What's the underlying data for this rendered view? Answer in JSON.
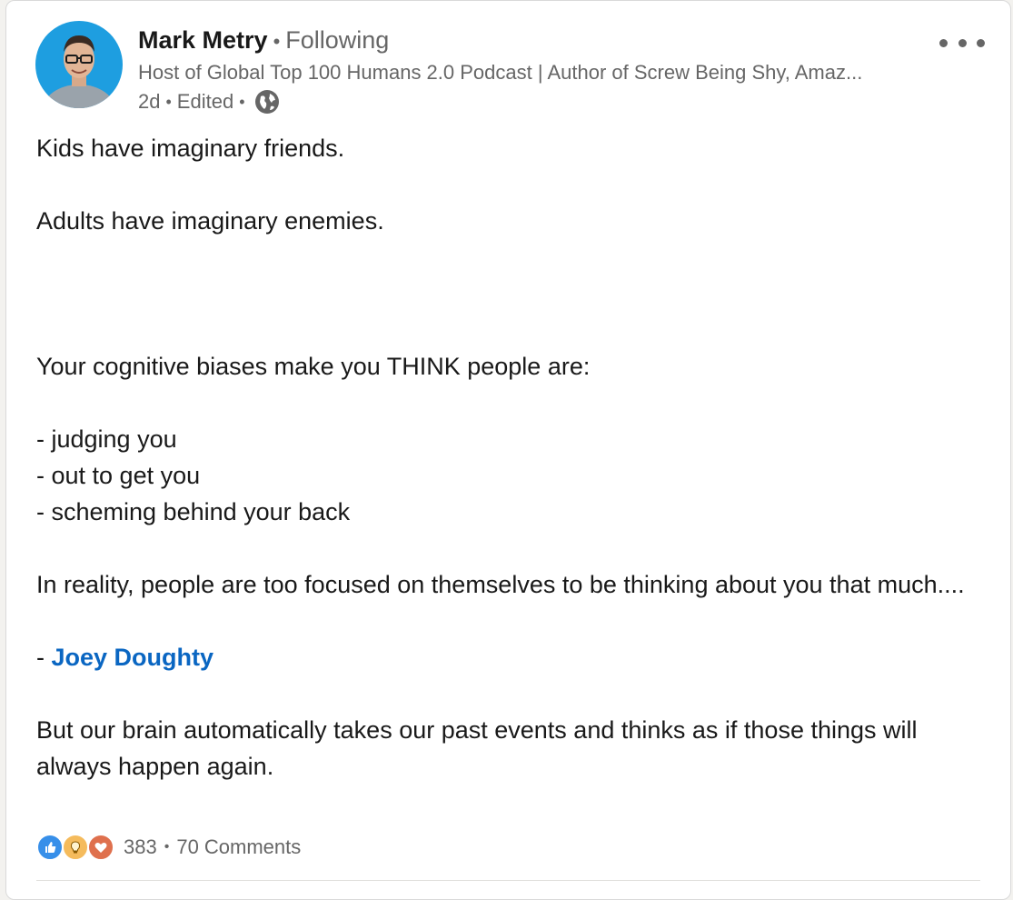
{
  "post": {
    "author": {
      "name": "Mark Metry",
      "follow_status": "Following",
      "headline": "Host of Global Top 100 Humans 2.0 Podcast | Author of Screw Being Shy, Amaz...",
      "time": "2d",
      "edited": "Edited"
    },
    "body": {
      "line1": "Kids have imaginary friends.",
      "line2": "Adults have imaginary enemies.",
      "line3": "Your cognitive biases make you THINK people are:",
      "bullet1": "- judging you",
      "bullet2": "- out to get you",
      "bullet3": "- scheming behind your back",
      "line4": "In reality, people are too focused on themselves to be thinking about you that much....",
      "quote_prefix": "- ",
      "mention": "Joey Doughty",
      "line5": "But our brain automatically takes our past events and thinks as if those things will always happen again."
    },
    "social": {
      "reaction_count": "383",
      "comments": "70 Comments",
      "reaction_icons": [
        "like-icon",
        "insightful-icon",
        "love-icon"
      ]
    }
  },
  "colors": {
    "link": "#0a66c2",
    "secondary_text": "#666666",
    "like": "#378fe9",
    "insightful": "#f5bb5c",
    "love": "#df704d"
  }
}
